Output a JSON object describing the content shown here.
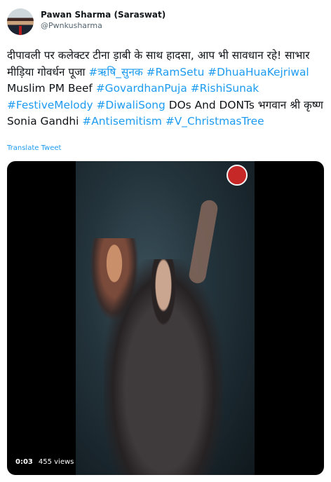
{
  "author": {
    "display_name": "Pawan Sharma (Saraswat)",
    "handle": "@Pwnkusharma"
  },
  "tweet": {
    "segments": [
      {
        "text": "दीपावली पर कलेक्टर टीना ड़ाबी के साथ हादसा, आप भी सावधान रहे! साभार मीड़िया गोवर्धन पूजा ",
        "type": "text"
      },
      {
        "text": "#ऋषि_सुनक",
        "type": "hashtag"
      },
      {
        "text": " ",
        "type": "text"
      },
      {
        "text": "#RamSetu",
        "type": "hashtag"
      },
      {
        "text": " ",
        "type": "text"
      },
      {
        "text": "#DhuaHuaKejriwal",
        "type": "hashtag"
      },
      {
        "text": " Muslim PM Beef ",
        "type": "text"
      },
      {
        "text": "#GovardhanPuja",
        "type": "hashtag"
      },
      {
        "text": " ",
        "type": "text"
      },
      {
        "text": "#RishiSunak",
        "type": "hashtag"
      },
      {
        "text": " ",
        "type": "text"
      },
      {
        "text": "#FestiveMelody",
        "type": "hashtag"
      },
      {
        "text": " ",
        "type": "text"
      },
      {
        "text": "#DiwaliSong",
        "type": "hashtag"
      },
      {
        "text": " DOs And DONTs  भगवान श्री कृष्ण Sonia Gandhi ",
        "type": "text"
      },
      {
        "text": "#Antisemitism",
        "type": "hashtag"
      },
      {
        "text": " ",
        "type": "text"
      },
      {
        "text": "#V_ChristmasTree",
        "type": "hashtag"
      }
    ],
    "translate_label": "Translate Tweet"
  },
  "video": {
    "time": "0:03",
    "views": "455 views"
  },
  "colors": {
    "hashtag": "#1d9bf0",
    "text": "#0f1419",
    "secondary": "#536471"
  }
}
